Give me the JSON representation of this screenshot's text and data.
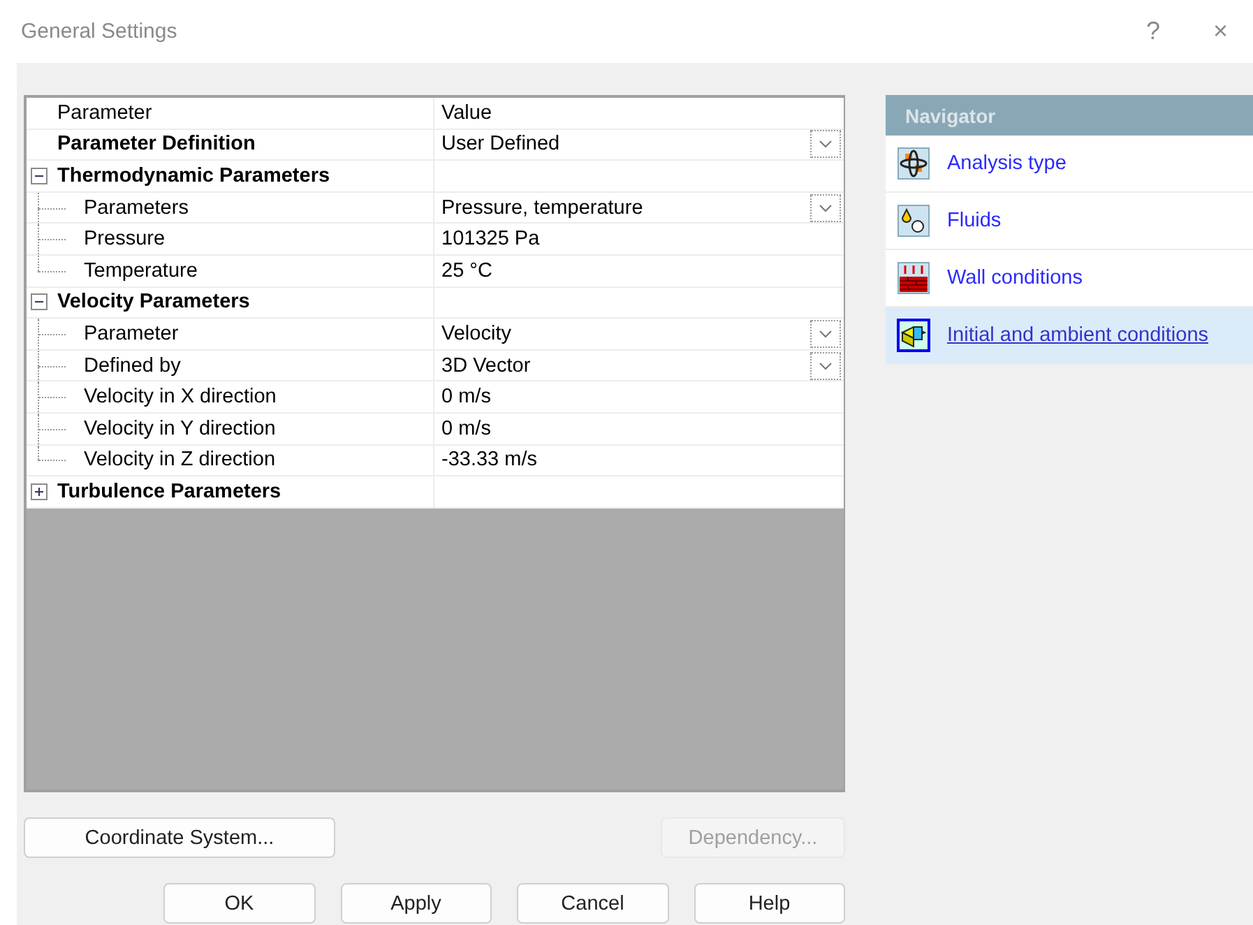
{
  "window": {
    "title": "General Settings",
    "help": "?",
    "close": "×"
  },
  "grid": {
    "columns": [
      "Parameter",
      "Value"
    ],
    "rows": [
      {
        "kind": "param",
        "name": "Parameter Definition",
        "value": "User Defined",
        "dropdown": true
      },
      {
        "kind": "group",
        "name": "Thermodynamic Parameters",
        "expanded": true,
        "children": [
          {
            "name": "Parameters",
            "value": "Pressure, temperature",
            "dropdown": true
          },
          {
            "name": "Pressure",
            "value": "101325 Pa",
            "dropdown": false
          },
          {
            "name": "Temperature",
            "value": "25 °C",
            "dropdown": false
          }
        ]
      },
      {
        "kind": "group",
        "name": "Velocity Parameters",
        "expanded": true,
        "children": [
          {
            "name": "Parameter",
            "value": "Velocity",
            "dropdown": true
          },
          {
            "name": "Defined by",
            "value": "3D Vector",
            "dropdown": true
          },
          {
            "name": "Velocity in X direction",
            "value": "0 m/s",
            "dropdown": false
          },
          {
            "name": "Velocity in Y direction",
            "value": "0 m/s",
            "dropdown": false
          },
          {
            "name": "Velocity in Z direction",
            "value": "-33.33 m/s",
            "dropdown": false
          }
        ]
      },
      {
        "kind": "group",
        "name": "Turbulence Parameters",
        "expanded": false,
        "children": []
      }
    ]
  },
  "navigator": {
    "title": "Navigator",
    "items": [
      {
        "label": "Analysis type",
        "selected": false
      },
      {
        "label": "Fluids",
        "selected": false
      },
      {
        "label": "Wall conditions",
        "selected": false
      },
      {
        "label": "Initial and ambient conditions",
        "selected": true
      }
    ]
  },
  "side_buttons": [
    {
      "label": "Coordinate System...",
      "disabled": false
    },
    {
      "label": "Dependency...",
      "disabled": true
    }
  ],
  "buttons": [
    "OK",
    "Apply",
    "Cancel",
    "Help"
  ]
}
